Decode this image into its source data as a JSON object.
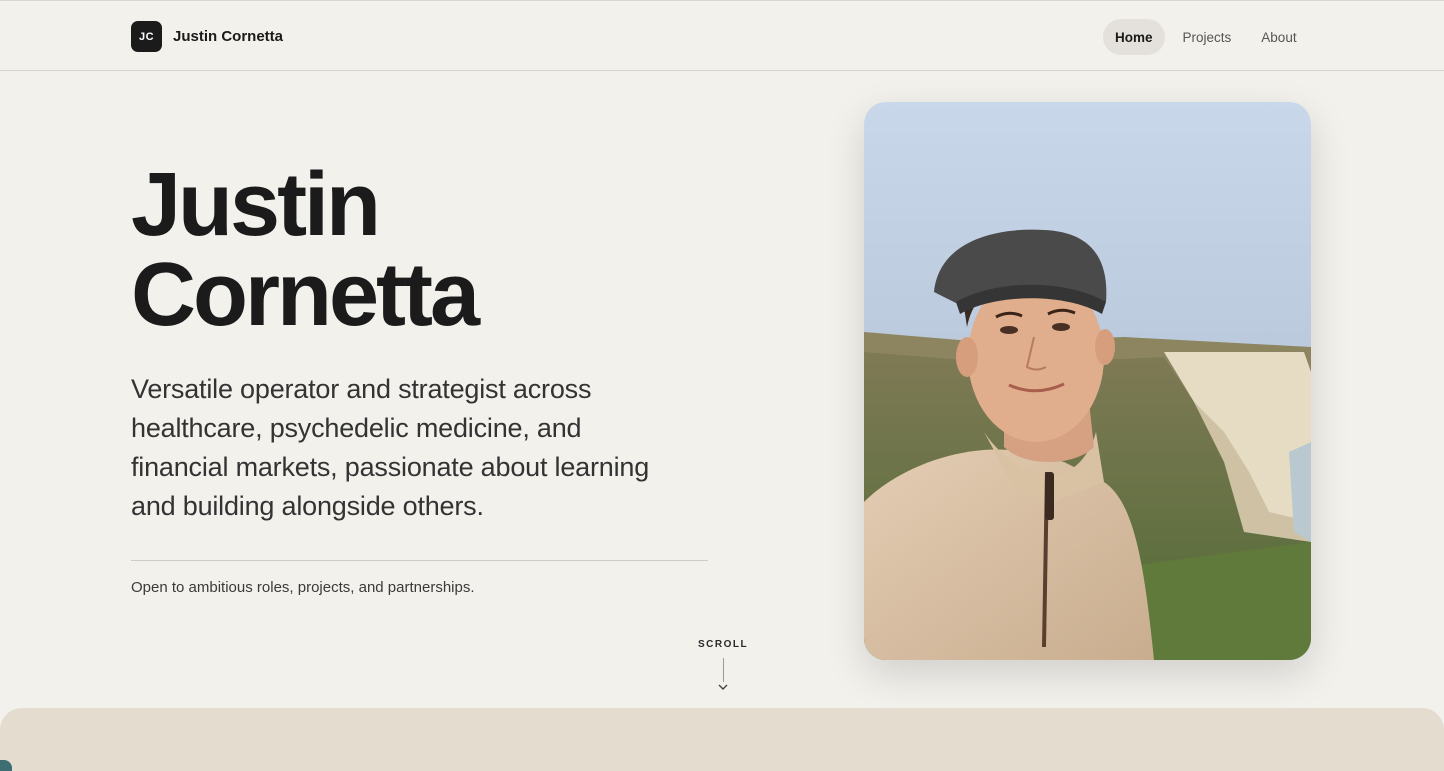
{
  "header": {
    "monogram": "JC",
    "brand_name": "Justin Cornetta",
    "nav": [
      {
        "label": "Home",
        "active": true
      },
      {
        "label": "Projects",
        "active": false
      },
      {
        "label": "About",
        "active": false
      }
    ]
  },
  "hero": {
    "name_line1": "Justin",
    "name_line2": "Cornetta",
    "tagline": "Versatile operator and strategist across healthcare, psychedelic medicine, and financial markets, passionate about learning and building alongside others.",
    "availability": "Open to ambitious roles, projects, and partnerships."
  },
  "scroll_cue": {
    "label": "SCROLL",
    "icon": "chevron-down-icon"
  },
  "portrait": {
    "alt": "Portrait photo of Justin Cornetta on a cliff top"
  },
  "colors": {
    "background": "#f3f1ec",
    "text": "#1b1b1b",
    "panel": "#e3dccf",
    "accent_teal": "#3e6e72"
  }
}
